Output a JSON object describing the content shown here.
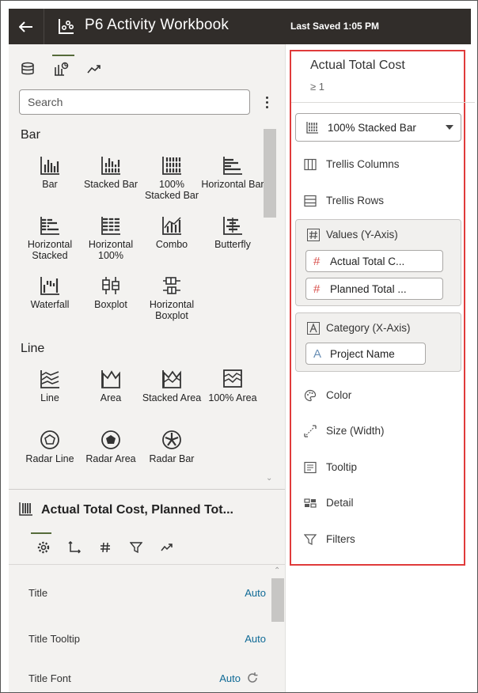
{
  "header": {
    "back_label": "←",
    "title": "P6 Activity Workbook",
    "last_saved": "Last Saved 1:05 PM"
  },
  "left": {
    "tabs": [
      "data-icon",
      "visualizations-icon",
      "analytics-icon"
    ],
    "search_placeholder": "Search",
    "sections": {
      "bar": {
        "heading": "Bar",
        "items": [
          "Bar",
          "Stacked Bar",
          "100% Stacked Bar",
          "Horizontal Bar",
          "Horizontal Stacked",
          "Horizontal 100%",
          "Combo",
          "Butterfly",
          "Waterfall",
          "Boxplot",
          "Horizontal Boxplot"
        ]
      },
      "line": {
        "heading": "Line",
        "items": [
          "Line",
          "Area",
          "Stacked Area",
          "100% Area",
          "Radar Line",
          "Radar Area",
          "Radar Bar"
        ]
      }
    },
    "properties": {
      "title": "Actual Total Cost, Planned Tot...",
      "tabs": [
        "gear-icon",
        "axis-icon",
        "hash-icon",
        "filter-icon",
        "analytics-icon"
      ],
      "rows": [
        {
          "label": "Title",
          "value": "Auto"
        },
        {
          "label": "Title Tooltip",
          "value": "Auto"
        },
        {
          "label": "Title Font",
          "value": "Auto"
        }
      ]
    }
  },
  "right": {
    "title": "Actual Total Cost",
    "subtitle": "≥ 1",
    "vis_type": "100% Stacked Bar",
    "grammar": {
      "trellis_columns": "Trellis Columns",
      "trellis_rows": "Trellis Rows",
      "values_label": "Values (Y-Axis)",
      "values": [
        "Actual Total C...",
        "Planned Total ..."
      ],
      "category_label": "Category (X-Axis)",
      "category": [
        "Project Name"
      ],
      "color": "Color",
      "size": "Size (Width)",
      "tooltip": "Tooltip",
      "detail": "Detail",
      "filters": "Filters"
    }
  },
  "colors": {
    "header_bg": "#312d2a",
    "panel_bg": "#f3f2f0",
    "highlight_border": "#e03b3b",
    "link": "#0f6a96",
    "measure_hash": "#d9534f",
    "attribute_a": "#6a8fb5",
    "active_tab": "#556b3a"
  }
}
